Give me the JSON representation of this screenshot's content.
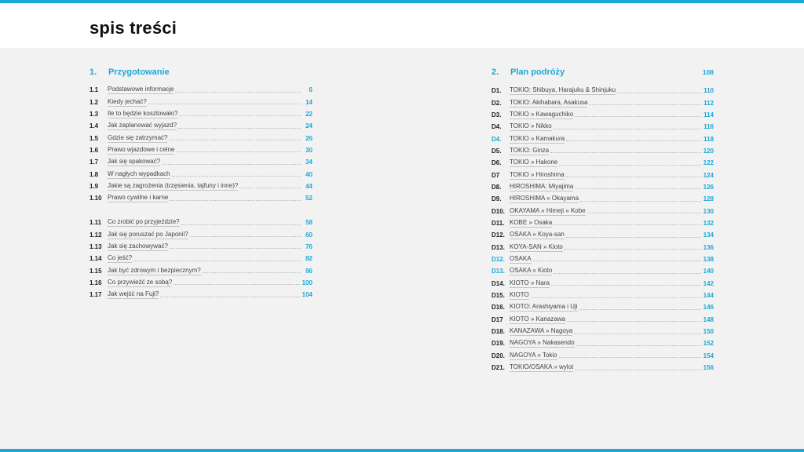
{
  "page_title": "spis treści",
  "colors": {
    "accent": "#1aa8d6",
    "background": "#f2f2f2",
    "header_bg": "#ffffff"
  },
  "section1": {
    "number": "1.",
    "title": "Przygotowanie",
    "group_a": [
      {
        "num": "1.1",
        "label": "Podstawowe informacje",
        "page": "6"
      },
      {
        "num": "1.2",
        "label": "Kiedy jechać?",
        "page": "14"
      },
      {
        "num": "1.3",
        "label": "Ile to będzie kosztowało?",
        "page": "22"
      },
      {
        "num": "1.4",
        "label": "Jak zaplanować wyjazd?",
        "page": "24"
      },
      {
        "num": "1.5",
        "label": "Gdzie się zatrzymać?",
        "page": "26"
      },
      {
        "num": "1.6",
        "label": "Prawo wjazdowe i celne",
        "page": "30"
      },
      {
        "num": "1.7",
        "label": "Jak się spakować?",
        "page": "34"
      },
      {
        "num": "1.8",
        "label": "W nagłych wypadkach",
        "page": "40"
      },
      {
        "num": "1.9",
        "label": "Jakie są zagrożenia (trzęsienia, tajfuny i inne)?",
        "page": "44"
      },
      {
        "num": "1.10",
        "label": "Prawo cywilne i karne",
        "page": "52"
      }
    ],
    "group_b": [
      {
        "num": "1.11",
        "label": "Co zrobić po przyjeździe?",
        "page": "58"
      },
      {
        "num": "1.12",
        "label": "Jak się poruszać po Japonii?",
        "page": "60"
      },
      {
        "num": "1.13",
        "label": "Jak się zachowywać?",
        "page": "76"
      },
      {
        "num": "1.14",
        "label": "Co jeść?",
        "page": "82"
      },
      {
        "num": "1.15",
        "label": "Jak być zdrowym i bezpiecznym?",
        "page": "96"
      },
      {
        "num": "1.16",
        "label": "Co przywieźć ze sobą?",
        "page": "100"
      },
      {
        "num": "1.17",
        "label": "Jak wejść na Fuji?",
        "page": "104"
      }
    ]
  },
  "section2": {
    "number": "2.",
    "title": "Plan podróży",
    "page": "108",
    "items": [
      {
        "num": "D1.",
        "label": "TOKIO: Shibuya, Harajuku & Shinjuku",
        "page": "110"
      },
      {
        "num": "D2.",
        "label": "TOKIO: Akihabara, Asakusa",
        "page": "112"
      },
      {
        "num": "D3.",
        "label": "TOKIO » Kawaguchiko",
        "page": "114"
      },
      {
        "num": "D4.",
        "label": "TOKIO » Nikko",
        "page": "116"
      },
      {
        "num": "D4.",
        "label": "TOKIO » Kamakura",
        "page": "118",
        "blue": true
      },
      {
        "num": "D5.",
        "label": "TOKIO: Ginza",
        "page": "120"
      },
      {
        "num": "D6.",
        "label": "TOKIO » Hakone",
        "page": "122"
      },
      {
        "num": "D7",
        "label": "TOKIO » Hiroshima",
        "page": "124"
      },
      {
        "num": "D8.",
        "label": "HIROSHIMA: Miyajima",
        "page": "126"
      },
      {
        "num": "D9.",
        "label": "HIROSHIMA » Okayama",
        "page": "128"
      },
      {
        "num": "D10.",
        "label": "OKAYAMA » Himeji » Kobe",
        "page": "130"
      },
      {
        "num": "D11.",
        "label": "KOBE » Osaka",
        "page": "132"
      },
      {
        "num": "D12.",
        "label": "OSAKA » Koya-san",
        "page": "134"
      },
      {
        "num": "D13.",
        "label": "KOYA-SAN » Kioto",
        "page": "136"
      },
      {
        "num": "D12.",
        "label": "OSAKA",
        "page": "138",
        "blue": true
      },
      {
        "num": "D13.",
        "label": "OSAKA » Kioto",
        "page": "140",
        "blue": true
      },
      {
        "num": "D14.",
        "label": "KIOTO » Nara",
        "page": "142"
      },
      {
        "num": "D15.",
        "label": "KIOTO",
        "page": "144"
      },
      {
        "num": "D16.",
        "label": "KIOTO: Arashiyama i Uji",
        "page": "146"
      },
      {
        "num": "D17",
        "label": "KIOTO » Kanazawa",
        "page": "148"
      },
      {
        "num": "D18.",
        "label": "KANAZAWA » Nagoya",
        "page": "150"
      },
      {
        "num": "D19.",
        "label": "NAGOYA » Nakasendo",
        "page": "152"
      },
      {
        "num": "D20.",
        "label": "NAGOYA » Tokio",
        "page": "154"
      },
      {
        "num": "D21.",
        "label": "TOKIO/OSAKA » wylot",
        "page": "156"
      }
    ]
  }
}
